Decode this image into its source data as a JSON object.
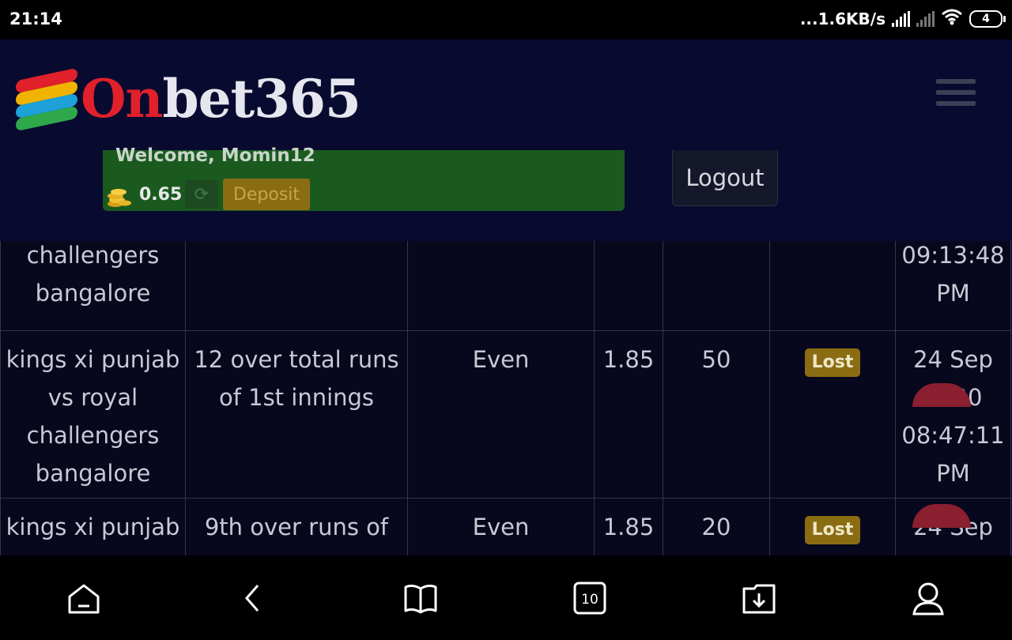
{
  "status_bar": {
    "time": "21:14",
    "net_speed": "...1.6KB/s",
    "battery": "4"
  },
  "header": {
    "logo_part1": "On",
    "logo_part2": "bet365",
    "welcome": "Welcome, Momin12",
    "balance": "0.65",
    "deposit_label": "Deposit",
    "logout_label": "Logout"
  },
  "table": {
    "rows": [
      {
        "match": [
          "challengers",
          "bangalore"
        ],
        "market": [
          ""
        ],
        "selection": "",
        "odds": "",
        "stake": "",
        "status": "",
        "datetime": [
          "09:13:48",
          "PM"
        ]
      },
      {
        "match": [
          "kings xi punjab",
          "vs royal",
          "challengers",
          "bangalore"
        ],
        "market": [
          "12 over total runs",
          "of 1st innings"
        ],
        "selection": "Even",
        "odds": "1.85",
        "stake": "50",
        "status": "Lost",
        "datetime": [
          "24 Sep",
          "2020",
          "08:47:11",
          "PM"
        ]
      },
      {
        "match": [
          "kings xi punjab",
          ""
        ],
        "market": [
          "9th over runs of",
          ""
        ],
        "selection": "Even",
        "odds": "1.85",
        "stake": "20",
        "status": "Lost",
        "datetime": [
          "24 Sep",
          ""
        ]
      }
    ]
  },
  "nav": {
    "tabs_count": "10"
  },
  "colors": {
    "background": "#07071d",
    "header_bg": "#090a30",
    "welcome_bg": "#1a5a1f",
    "accent_gold": "#8a6d12",
    "logo_red": "#e0202a"
  }
}
